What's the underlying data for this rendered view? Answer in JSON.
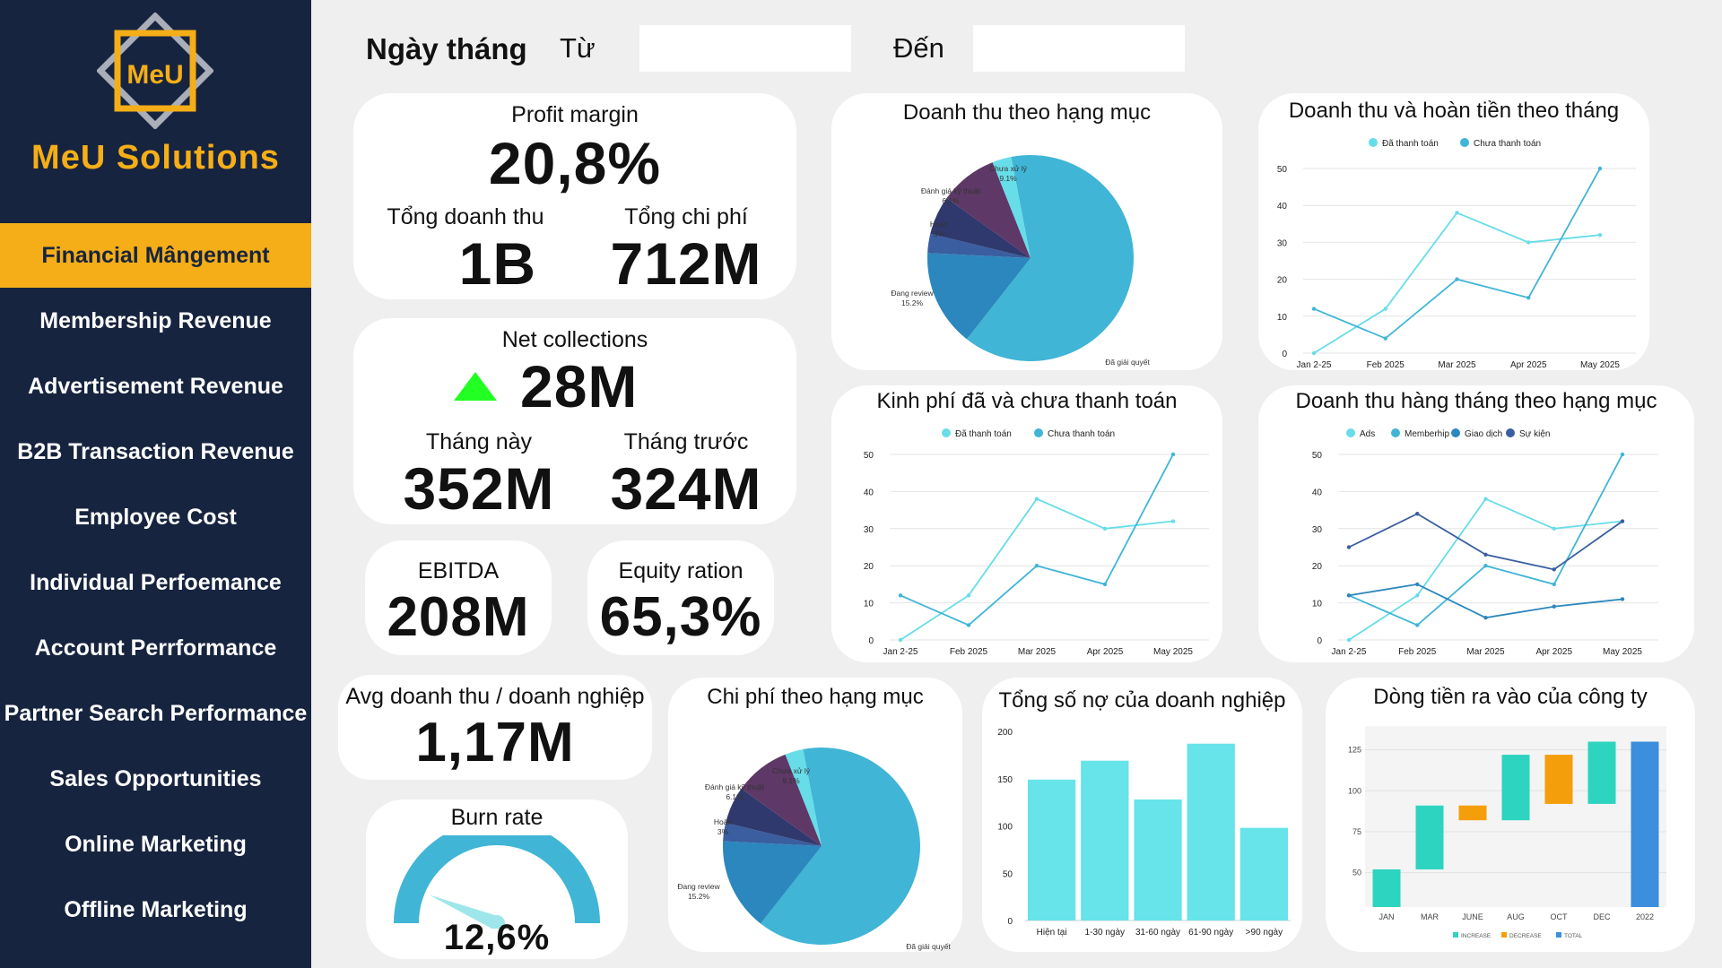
{
  "sidebar": {
    "logo_text": "MeU",
    "brand": "MeU Solutions",
    "items": [
      {
        "label": "Financial Mângement",
        "active": true
      },
      {
        "label": "Membership Revenue"
      },
      {
        "label": "Advertisement Revenue"
      },
      {
        "label": "B2B Transaction Revenue"
      },
      {
        "label": "Employee Cost"
      },
      {
        "label": "Individual Perfoemance"
      },
      {
        "label": "Account Perrformance"
      },
      {
        "label": "Partner Search Performance"
      },
      {
        "label": "Sales Opportunities"
      },
      {
        "label": "Online Marketing"
      },
      {
        "label": "Offline Marketing"
      }
    ]
  },
  "filter": {
    "date_label": "Ngày tháng",
    "from_label": "Từ",
    "to_label": "Đến",
    "from_value": "",
    "to_value": ""
  },
  "kpi": {
    "profit_margin_label": "Profit margin",
    "profit_margin": "20,8%",
    "total_revenue_label": "Tổng doanh thu",
    "total_revenue": "1B",
    "total_cost_label": "Tổng chi phí",
    "total_cost": "712M",
    "net_collections_label": "Net collections",
    "net_collections": "28M",
    "this_month_label": "Tháng này",
    "this_month": "352M",
    "last_month_label": "Tháng trước",
    "last_month": "324M",
    "ebitda_label": "EBITDA",
    "ebitda": "208M",
    "equity_label": "Equity ration",
    "equity": "65,3%",
    "avg_label": "Avg doanh thu / doanh nghiệp",
    "avg": "1,17M",
    "burn_label": "Burn rate",
    "burn": "12,6%",
    "burn_fraction": 0.126
  },
  "colors": {
    "sidebar": "#17243f",
    "accent": "#f5ae17",
    "cyan": "#67dde8",
    "blue": "#40b5d6",
    "green": "#22ff22",
    "wf_increase": "#2dd4bf",
    "wf_decrease": "#f59e0b",
    "wf_total": "#3b8fdc"
  },
  "chart_data": [
    {
      "type": "pie",
      "title": "Doanh thu theo hạng mục",
      "slices": [
        {
          "label": "Đã giải quyết",
          "value": 63.6,
          "pct": "63.6%",
          "color": "#40b5d6"
        },
        {
          "label": "Đang review",
          "value": 15.2,
          "pct": "15.2%",
          "color": "#2b87bd"
        },
        {
          "label": "Hoàn",
          "value": 3,
          "pct": "3%",
          "color": "#3a5ea0"
        },
        {
          "label": "Đánh giá kỹ thuật",
          "value": 6.1,
          "pct": "6.1%",
          "color": "#30396d"
        },
        {
          "label": "Chưa xử lý",
          "value": 9.1,
          "pct": "9.1%",
          "color": "#5e3867"
        },
        {
          "label": "",
          "value": 3,
          "pct": "",
          "color": "#67dde8"
        }
      ]
    },
    {
      "type": "line",
      "title": "Doanh thu và hoàn tiền theo tháng",
      "categories": [
        "Jan 2-25",
        "Feb 2025",
        "Mar 2025",
        "Apr 2025",
        "May 2025"
      ],
      "ylim": [
        0,
        50
      ],
      "yticks": [
        "0",
        "10",
        "20",
        "30",
        "40",
        "50"
      ],
      "legend": "top-center",
      "series": [
        {
          "name": "Đã thanh toán",
          "color": "#67dde8",
          "values": [
            0,
            12,
            38,
            30,
            32
          ]
        },
        {
          "name": "Chưa thanh toán",
          "color": "#40b5d6",
          "values": [
            12,
            4,
            20,
            15,
            50
          ]
        }
      ]
    },
    {
      "type": "line",
      "title": "Kinh phí đã và chưa thanh toán",
      "categories": [
        "Jan 2-25",
        "Feb 2025",
        "Mar 2025",
        "Apr 2025",
        "May 2025"
      ],
      "ylim": [
        0,
        50
      ],
      "yticks": [
        "0",
        "10",
        "20",
        "30",
        "40",
        "50"
      ],
      "legend": "top-center",
      "series": [
        {
          "name": "Đã thanh toán",
          "color": "#67dde8",
          "values": [
            0,
            12,
            38,
            30,
            32
          ]
        },
        {
          "name": "Chưa thanh toán",
          "color": "#40b5d6",
          "values": [
            12,
            4,
            20,
            15,
            50
          ]
        }
      ]
    },
    {
      "type": "line",
      "title": "Doanh thu hàng tháng theo hạng mục",
      "categories": [
        "Jan 2-25",
        "Feb 2025",
        "Mar 2025",
        "Apr 2025",
        "May 2025"
      ],
      "ylim": [
        0,
        50
      ],
      "yticks": [
        "0",
        "10",
        "20",
        "30",
        "40",
        "50"
      ],
      "legend": "top-center",
      "series": [
        {
          "name": "Ads",
          "color": "#67dde8",
          "values": [
            0,
            12,
            38,
            30,
            32
          ]
        },
        {
          "name": "Memberhip",
          "color": "#40b5d6",
          "values": [
            12,
            4,
            20,
            15,
            50
          ]
        },
        {
          "name": "Giao dịch",
          "color": "#2b87bd",
          "values": [
            12,
            15,
            6,
            9,
            11
          ]
        },
        {
          "name": "Sự kiện",
          "color": "#3a5ea0",
          "values": [
            25,
            34,
            23,
            19,
            32
          ]
        }
      ]
    },
    {
      "type": "pie",
      "title": "Chi phí theo hạng mục",
      "slices": [
        {
          "label": "Đã giải quyết",
          "value": 63.6,
          "pct": "63.6%",
          "color": "#40b5d6"
        },
        {
          "label": "Đang review",
          "value": 15.2,
          "pct": "15.2%",
          "color": "#2b87bd"
        },
        {
          "label": "Hoàn",
          "value": 3,
          "pct": "3%",
          "color": "#3a5ea0"
        },
        {
          "label": "Đánh giá kỹ thuật",
          "value": 6.1,
          "pct": "6.1%",
          "color": "#30396d"
        },
        {
          "label": "Chưa xử lý",
          "value": 9.1,
          "pct": "9.1%",
          "color": "#5e3867"
        },
        {
          "label": "",
          "value": 3,
          "pct": "",
          "color": "#67dde8"
        }
      ]
    },
    {
      "type": "bar",
      "title": "Tổng số nợ của doanh nghiệp",
      "categories": [
        "Hiện tại",
        "1-30 ngày",
        "31-60 ngày",
        "61-90 ngày",
        ">90 ngày"
      ],
      "values": [
        149,
        169,
        128,
        187,
        98
      ],
      "ylim": [
        0,
        200
      ],
      "yticks": [
        "0",
        "50",
        "100",
        "150",
        "200"
      ],
      "color": "#67e3ea"
    },
    {
      "type": "bar",
      "subtype": "waterfall",
      "title": "Dòng tiền ra vào của công ty",
      "categories": [
        "JAN",
        "MAR",
        "JUNE",
        "AUG",
        "OCT",
        "DEC",
        "2022"
      ],
      "bars": [
        {
          "start": 29,
          "end": 52,
          "kind": "increase"
        },
        {
          "start": 52,
          "end": 91,
          "kind": "increase"
        },
        {
          "start": 91,
          "end": 82,
          "kind": "decrease"
        },
        {
          "start": 82,
          "end": 122,
          "kind": "increase"
        },
        {
          "start": 122,
          "end": 92,
          "kind": "decrease"
        },
        {
          "start": 92,
          "end": 130,
          "kind": "increase"
        },
        {
          "start": 29,
          "end": 130,
          "kind": "total"
        }
      ],
      "ylim": [
        29,
        133
      ],
      "yticks": [
        50,
        75,
        100,
        125
      ],
      "legend": [
        "INCREASE",
        "DECREASE",
        "TOTAL"
      ]
    }
  ]
}
